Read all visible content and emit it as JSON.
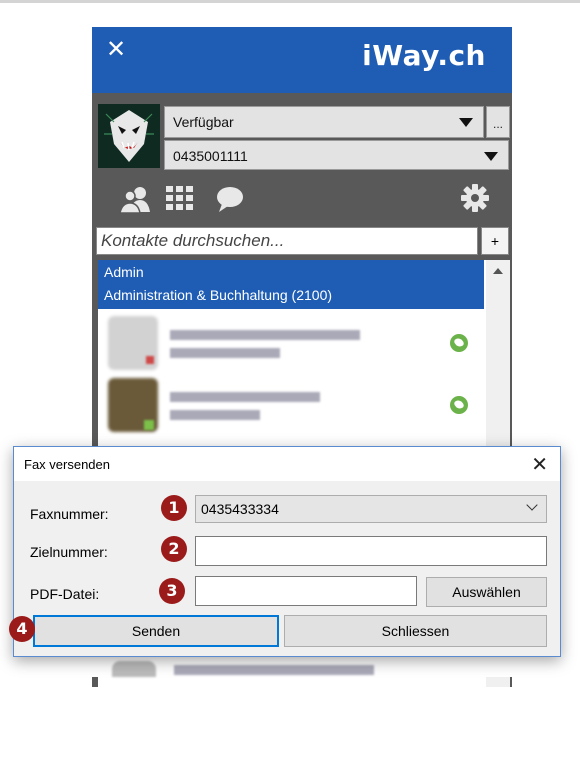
{
  "app": {
    "close_label": "✕",
    "logo": "iWay.ch",
    "status": "Verfügbar",
    "more_label": "...",
    "phone_number": "0435001111",
    "search_placeholder": "Kontakte durchsuchen...",
    "add_label": "+",
    "group": {
      "line1": "Admin",
      "line2": "Administration & Buchhaltung (2100)"
    },
    "icons": [
      "contacts-icon",
      "dialpad-icon",
      "chat-icon",
      "gear-icon"
    ]
  },
  "dialog": {
    "title": "Fax versenden",
    "close_label": "✕",
    "fax_label": "Faxnummer:",
    "fax_value": "0435433334",
    "target_label": "Zielnummer:",
    "target_value": "",
    "pdf_label": "PDF-Datei:",
    "pdf_value": "",
    "choose_label": "Auswählen",
    "send_label": "Senden",
    "close_button_label": "Schliessen"
  },
  "badges": [
    "1",
    "2",
    "3",
    "4"
  ],
  "colors": {
    "brand_blue": "#1f5db5",
    "badge_red": "#9b1b1b",
    "call_green": "#6bb24a"
  }
}
